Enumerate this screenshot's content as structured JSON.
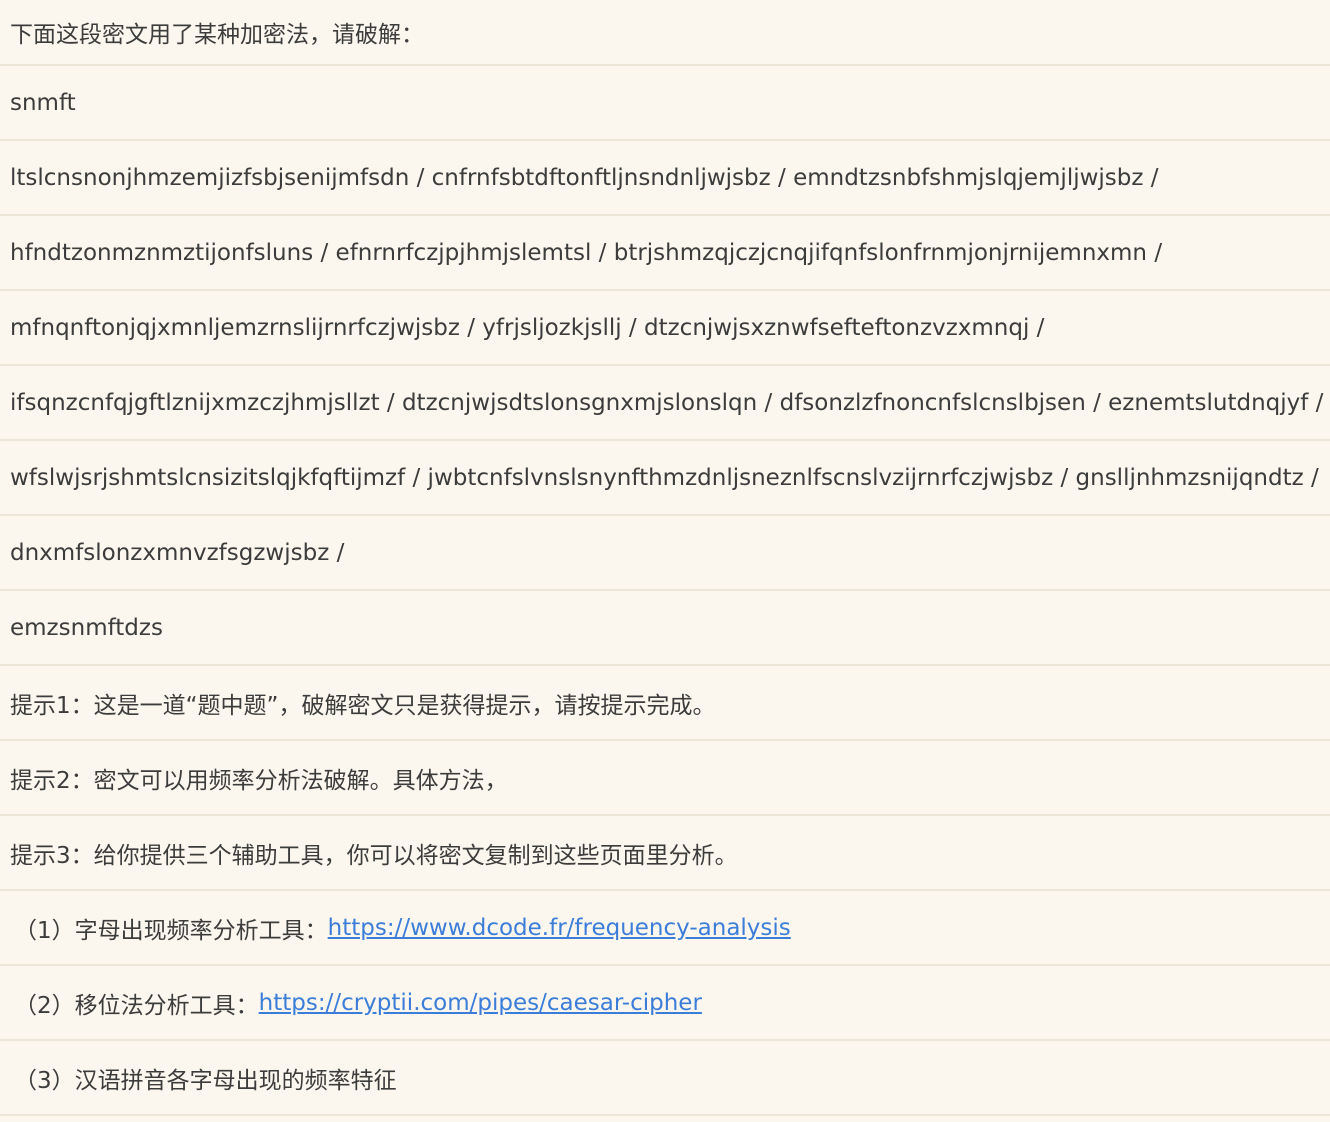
{
  "intro": "下面这段密文用了某种加密法，请破解：",
  "cipher_lines": [
    "snmft",
    "ltslcnsnonjhmzemjizfsbjsenijmfsdn / cnfrnfsbtdftonftljnsndnljwjsbz / emndtzsnbfshmjslqjemjljwjsbz /",
    "hfndtzonmznmztijonfsluns / efnrnrfczjpjhmjslemtsl / btrjshmzqjczjcnqjifqnfslonfrnmjonjrnijemnxmn /",
    "mfnqnftonjqjxmnljemzrnslijrnrfczjwjsbz / yfrjsljozkjsllj / dtzcnjwjsxznwfsefteftonzvzxmnqj /",
    "ifsqnzcnfqjgftlznijxmzczjhmjsllzt / dtzcnjwjsdtslonsgnxmjslonslqn / dfsonzlzfnoncnfslcnslbjsen / eznemtslutdnqjyf /",
    "wfslwjsrjshmtslcnsizitslqjkfqftijmzf / jwbtcnfslvnslsnynfthmzdnljsneznlfscnslvzijrnrfczjwjsbz / gnslljnhmzsnijqndtz /",
    "dnxmfslonzxmnvzfsgzwjsbz /",
    "emzsnmftdzs"
  ],
  "hints": [
    "提示1：这是一道“题中题”，破解密文只是获得提示，请按提示完成。",
    "提示2：密文可以用频率分析法破解。具体方法，",
    "提示3：给你提供三个辅助工具，你可以将密文复制到这些页面里分析。"
  ],
  "tools": [
    {
      "prefix": "（1）字母出现频率分析工具：",
      "link": "https://www.dcode.fr/frequency-analysis"
    },
    {
      "prefix": "（2）移位法分析工具：",
      "link": "https://cryptii.com/pipes/caesar-cipher"
    },
    {
      "prefix": "（3）汉语拼音各字母出现的频率特征",
      "link": ""
    }
  ]
}
